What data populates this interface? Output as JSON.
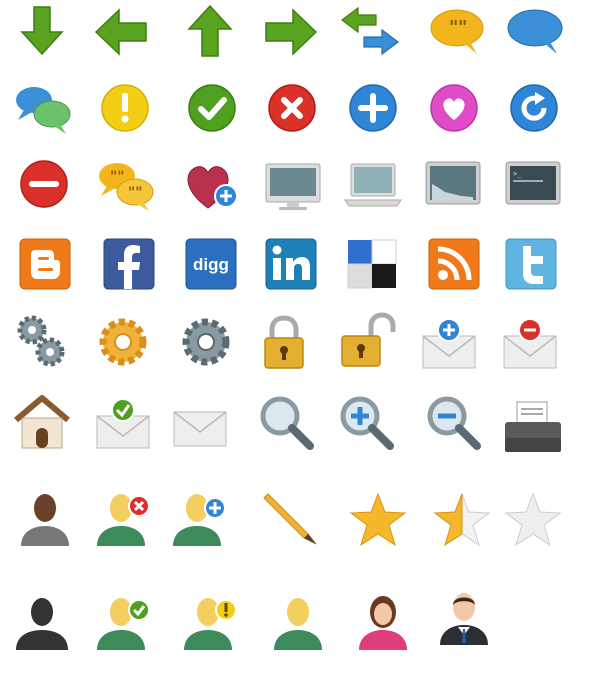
{
  "icons": [
    {
      "name": "arrow-down-icon",
      "color": "#5aa320"
    },
    {
      "name": "arrow-left-icon",
      "color": "#5aa320"
    },
    {
      "name": "arrow-up-icon",
      "color": "#5aa320"
    },
    {
      "name": "arrow-right-icon",
      "color": "#5aa320"
    },
    {
      "name": "swap-arrows-icon",
      "color": "#5aa320"
    },
    {
      "name": "quote-speech-bubble-icon",
      "color": "#f2b51c"
    },
    {
      "name": "speech-bubble-icon",
      "color": "#3a8fd6"
    },
    {
      "name": "chat-bubbles-icon",
      "color": "#3a8fd6"
    },
    {
      "name": "warning-icon",
      "color": "#f2cf16"
    },
    {
      "name": "check-icon",
      "color": "#4fa020"
    },
    {
      "name": "close-icon",
      "color": "#d9302a"
    },
    {
      "name": "plus-icon",
      "color": "#2f86d6"
    },
    {
      "name": "heart-icon",
      "color": "#e04cc8"
    },
    {
      "name": "refresh-icon",
      "color": "#2f86d6"
    },
    {
      "name": "minus-icon",
      "color": "#d9302a"
    },
    {
      "name": "quote-chat-bubbles-icon",
      "color": "#f2b51c"
    },
    {
      "name": "heart-add-icon",
      "color": "#b8324e"
    },
    {
      "name": "monitor-icon",
      "color": "#dddddd"
    },
    {
      "name": "laptop-icon",
      "color": "#dddddd"
    },
    {
      "name": "chart-display-icon",
      "color": "#cfcfcf"
    },
    {
      "name": "terminal-display-icon",
      "color": "#cfcfcf"
    },
    {
      "name": "blogger-icon",
      "color": "#f07a1a"
    },
    {
      "name": "facebook-icon",
      "color": "#3b5b9e"
    },
    {
      "name": "digg-icon",
      "color": "#2a6fc0"
    },
    {
      "name": "linkedin-icon",
      "color": "#1f7fb8"
    },
    {
      "name": "delicious-icon",
      "color": "#2f6fd0"
    },
    {
      "name": "rss-icon",
      "color": "#f07a1a"
    },
    {
      "name": "twitter-icon",
      "color": "#5fb4e0"
    },
    {
      "name": "gears-icon",
      "color": "#8a9aa2"
    },
    {
      "name": "gear-gold-icon",
      "color": "#f2b23a"
    },
    {
      "name": "gear-icon",
      "color": "#8a9aa2"
    },
    {
      "name": "lock-closed-icon",
      "color": "#e4b032"
    },
    {
      "name": "lock-open-icon",
      "color": "#e4b032"
    },
    {
      "name": "mail-add-icon",
      "color": "#2f86d6"
    },
    {
      "name": "mail-remove-icon",
      "color": "#d9302a"
    },
    {
      "name": "home-icon",
      "color": "#8a5a30"
    },
    {
      "name": "mail-check-icon",
      "color": "#4fa020"
    },
    {
      "name": "mail-icon",
      "color": "#e6e6e6"
    },
    {
      "name": "search-icon",
      "color": "#8a9aa2"
    },
    {
      "name": "zoom-in-icon",
      "color": "#2f86d6"
    },
    {
      "name": "zoom-out-icon",
      "color": "#2f86d6"
    },
    {
      "name": "printer-icon",
      "color": "#5a5a5a"
    },
    {
      "name": "user-icon",
      "color": "#6a4028"
    },
    {
      "name": "user-remove-icon",
      "color": "#d9302a"
    },
    {
      "name": "user-add-icon",
      "color": "#2f86d6"
    },
    {
      "name": "pencil-icon",
      "color": "#f2b23a"
    },
    {
      "name": "star-full-icon",
      "color": "#f5b82a"
    },
    {
      "name": "star-half-icon",
      "color": "#f5b82a"
    },
    {
      "name": "star-empty-icon",
      "color": "#e8e8e8"
    },
    {
      "name": "user-silhouette-icon",
      "color": "#333333"
    },
    {
      "name": "user-check-icon",
      "color": "#4fa020"
    },
    {
      "name": "user-warning-icon",
      "color": "#f2cf16"
    },
    {
      "name": "user-blond-icon",
      "color": "#f2cf5e"
    },
    {
      "name": "user-female-icon",
      "color": "#e03e7a"
    },
    {
      "name": "user-business-icon",
      "color": "#2a2f38"
    }
  ]
}
